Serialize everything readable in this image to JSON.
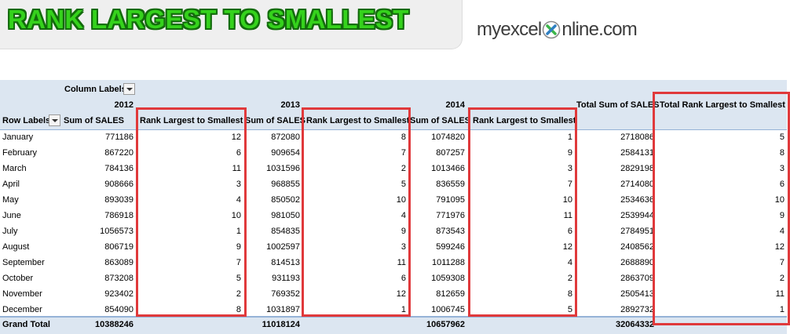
{
  "banner": {
    "title": "RANK LARGEST TO SMALLEST"
  },
  "logo": {
    "text_before": "myexcel",
    "text_after": "nline.com",
    "tagline": ""
  },
  "pivot": {
    "column_labels": "Column Labels",
    "row_labels": "Row Labels",
    "years": [
      "2012",
      "2013",
      "2014"
    ],
    "total_sum_header": "Total Sum of SALES",
    "total_rank_header": "Total  Rank Largest to Smallest",
    "sum_header": "Sum of SALES",
    "rank_header": "Rank Largest to Smallest",
    "grand_total_label": "Grand Total",
    "rows": [
      {
        "month": "January",
        "s2012": "771186",
        "r2012": "12",
        "s2013": "872080",
        "r2013": "8",
        "s2014": "1074820",
        "r2014": "1",
        "total": "2718086",
        "trank": "5"
      },
      {
        "month": "February",
        "s2012": "867220",
        "r2012": "6",
        "s2013": "909654",
        "r2013": "7",
        "s2014": "807257",
        "r2014": "9",
        "total": "2584131",
        "trank": "8"
      },
      {
        "month": "March",
        "s2012": "784136",
        "r2012": "11",
        "s2013": "1031596",
        "r2013": "2",
        "s2014": "1013466",
        "r2014": "3",
        "total": "2829198",
        "trank": "3"
      },
      {
        "month": "April",
        "s2012": "908666",
        "r2012": "3",
        "s2013": "968855",
        "r2013": "5",
        "s2014": "836559",
        "r2014": "7",
        "total": "2714080",
        "trank": "6"
      },
      {
        "month": "May",
        "s2012": "893039",
        "r2012": "4",
        "s2013": "850502",
        "r2013": "10",
        "s2014": "791095",
        "r2014": "10",
        "total": "2534636",
        "trank": "10"
      },
      {
        "month": "June",
        "s2012": "786918",
        "r2012": "10",
        "s2013": "981050",
        "r2013": "4",
        "s2014": "771976",
        "r2014": "11",
        "total": "2539944",
        "trank": "9"
      },
      {
        "month": "July",
        "s2012": "1056573",
        "r2012": "1",
        "s2013": "854835",
        "r2013": "9",
        "s2014": "873543",
        "r2014": "6",
        "total": "2784951",
        "trank": "4"
      },
      {
        "month": "August",
        "s2012": "806719",
        "r2012": "9",
        "s2013": "1002597",
        "r2013": "3",
        "s2014": "599246",
        "r2014": "12",
        "total": "2408562",
        "trank": "12"
      },
      {
        "month": "September",
        "s2012": "863089",
        "r2012": "7",
        "s2013": "814513",
        "r2013": "11",
        "s2014": "1011288",
        "r2014": "4",
        "total": "2688890",
        "trank": "7"
      },
      {
        "month": "October",
        "s2012": "873208",
        "r2012": "5",
        "s2013": "931193",
        "r2013": "6",
        "s2014": "1059308",
        "r2014": "2",
        "total": "2863709",
        "trank": "2"
      },
      {
        "month": "November",
        "s2012": "923402",
        "r2012": "2",
        "s2013": "769352",
        "r2013": "12",
        "s2014": "812659",
        "r2014": "8",
        "total": "2505413",
        "trank": "11"
      },
      {
        "month": "December",
        "s2012": "854090",
        "r2012": "8",
        "s2013": "1031897",
        "r2013": "1",
        "s2014": "1006745",
        "r2014": "5",
        "total": "2892732",
        "trank": "1"
      }
    ],
    "grand_total": {
      "s2012": "10388246",
      "s2013": "11018124",
      "s2014": "10657962",
      "total": "32064332"
    }
  },
  "colors": {
    "header_fill": "#dce6f1",
    "highlight_box": "#e0393b",
    "title_green": "#35d21c",
    "logo_green": "#3cb54a",
    "logo_blue": "#2f7fc1"
  }
}
